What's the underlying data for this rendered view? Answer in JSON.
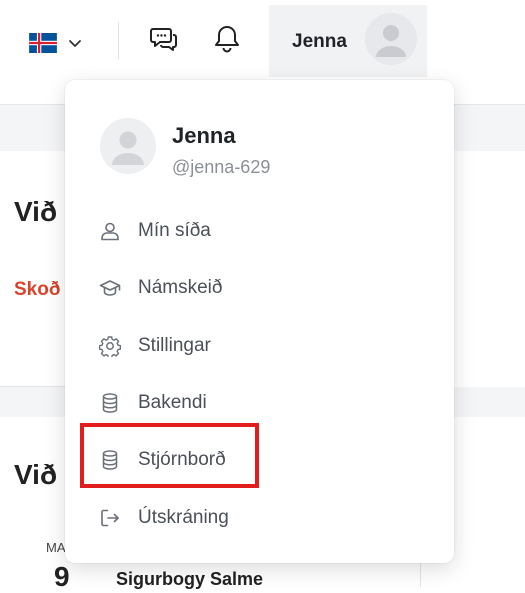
{
  "navbar": {
    "language_flag": "iceland-flag-icon",
    "user_button_name": "Jenna"
  },
  "background_page": {
    "heading_1": "Við",
    "link": "Skoð",
    "heading_2": "Við",
    "small_text": "MA",
    "day_number": "9",
    "name_text": "Sigurbogy Salme"
  },
  "dropdown": {
    "user": {
      "name": "Jenna",
      "handle": "@jenna-629"
    },
    "items": [
      {
        "label": "Mín síða",
        "icon": "user-icon"
      },
      {
        "label": "Námskeið",
        "icon": "graduation-cap-icon"
      },
      {
        "label": "Stillingar",
        "icon": "gear-icon"
      },
      {
        "label": "Bakendi",
        "icon": "database-icon"
      },
      {
        "label": "Stjórnborð",
        "icon": "database-icon",
        "highlighted": true
      },
      {
        "label": "Útskráning",
        "icon": "logout-icon"
      }
    ]
  },
  "colors": {
    "highlight": "#e21d1d",
    "accent_link": "#d9432b",
    "user_button_bg": "#f1f2f4"
  }
}
